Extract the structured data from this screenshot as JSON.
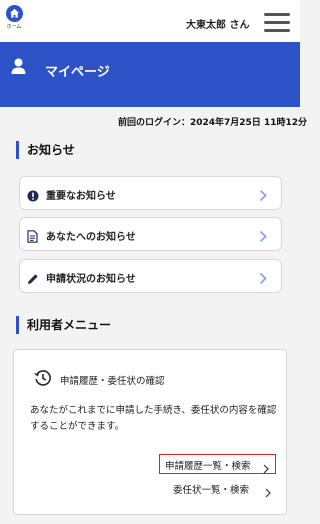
{
  "header": {
    "home_label": "ホーム",
    "user_name": "大東太郎 さん"
  },
  "banner": {
    "title": "マイページ"
  },
  "last_login": "前回のログイン：2024年7月25日 11時12分",
  "notices": {
    "heading": "お知らせ",
    "items": [
      {
        "label": "重要なお知らせ",
        "icon": "exclamation-circle-icon"
      },
      {
        "label": "あなたへのお知らせ",
        "icon": "document-icon"
      },
      {
        "label": "申請状況のお知らせ",
        "icon": "pencil-icon"
      }
    ]
  },
  "user_menu": {
    "heading": "利用者メニュー",
    "card": {
      "title": "申請履歴・委任状の確認",
      "icon": "history-icon",
      "description": "あなたがこれまでに申請した手続き、委任状の内容を確認することができます。",
      "links": [
        {
          "label": "申請履歴一覧・検索",
          "highlighted": true
        },
        {
          "label": "委任状一覧・検索",
          "highlighted": false
        }
      ]
    }
  },
  "colors": {
    "brand_blue": "#2d52c8",
    "highlight_red": "#d8262b",
    "chevron_blue": "#8aa6d8"
  }
}
